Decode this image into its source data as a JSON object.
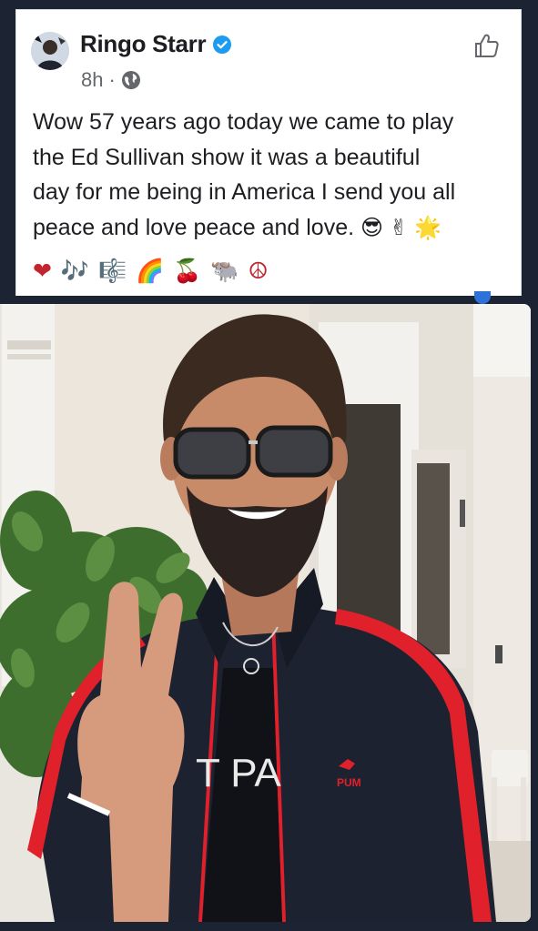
{
  "post": {
    "author": "Ringo Starr",
    "time": "8h",
    "separator": "·",
    "text_lines": [
      "Wow 57 years ago today we came to play",
      "the Ed Sullivan show it was a beautiful",
      "day for me being in America I send you all",
      "peace and love peace and love."
    ],
    "text_emojis": [
      "😎",
      "✌",
      "🌟"
    ],
    "emoji_line": [
      "❤",
      "🎶",
      "🎼",
      "🌈",
      "🍒",
      "🐃",
      "☮"
    ],
    "icons": {
      "verified": "verified-badge-icon",
      "audience": "globe-icon",
      "reaction": "thumbs-up-icon"
    }
  },
  "photo": {
    "shirt_text": "T PA",
    "brand_text": "PUM"
  },
  "colors": {
    "verified_blue": "#1d9bf0",
    "jacket_red": "#e0202a",
    "background_dark": "#1c2433"
  }
}
